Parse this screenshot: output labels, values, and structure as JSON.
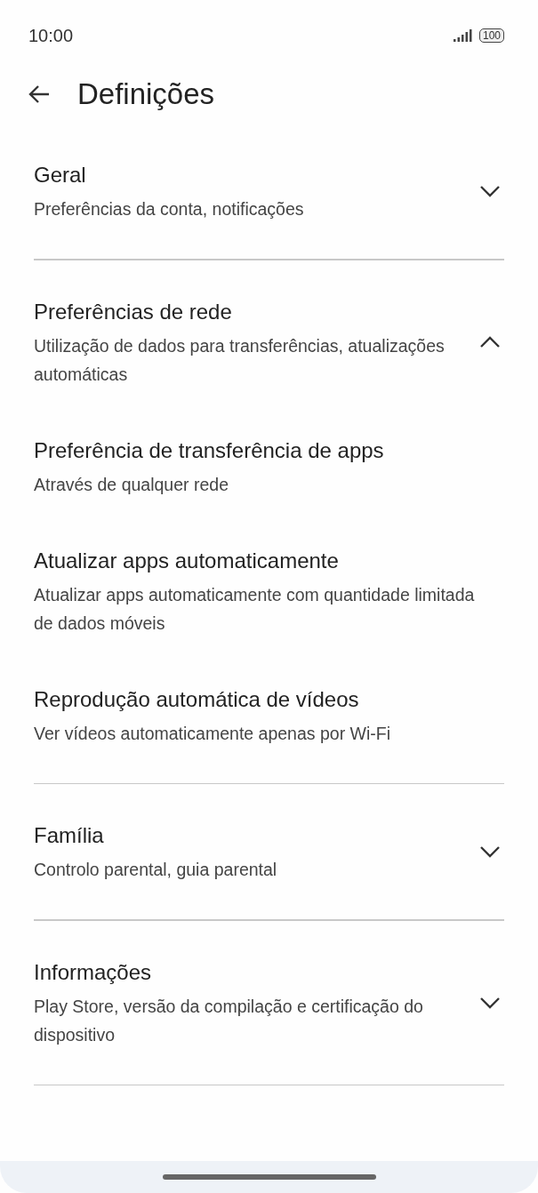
{
  "status_bar": {
    "time": "10:00",
    "battery": "100"
  },
  "header": {
    "title": "Definições"
  },
  "sections": [
    {
      "title": "Geral",
      "subtitle": "Preferências da conta, notificações",
      "expanded": false
    },
    {
      "title": "Preferências de rede",
      "subtitle": "Utilização de dados para transferências, atualizações automáticas",
      "expanded": true,
      "children": [
        {
          "title": "Preferência de transferência de apps",
          "subtitle": "Através de qualquer rede"
        },
        {
          "title": "Atualizar apps automaticamente",
          "subtitle": "Atualizar apps automaticamente com quantidade limitada de dados móveis"
        },
        {
          "title": "Reprodução automática de vídeos",
          "subtitle": "Ver vídeos automaticamente apenas por Wi-Fi"
        }
      ]
    },
    {
      "title": "Família",
      "subtitle": "Controlo parental, guia parental",
      "expanded": false
    },
    {
      "title": "Informações",
      "subtitle": "Play Store, versão da compilação e certificação do dispositivo",
      "expanded": false
    }
  ]
}
